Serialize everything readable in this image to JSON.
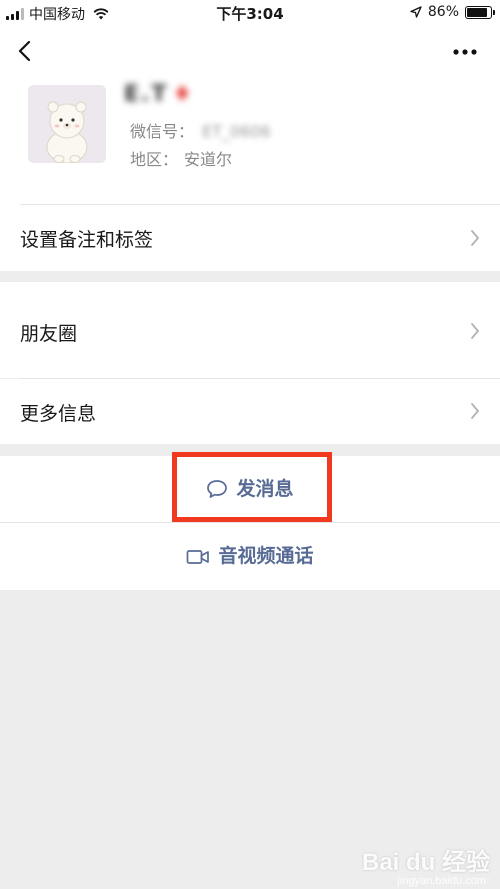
{
  "status_bar": {
    "carrier": "中国移动",
    "time": "下午3:04",
    "battery": "86%",
    "battery_level": 0.86,
    "icons": [
      "signal-icon",
      "wifi-icon",
      "location-arrow-icon",
      "battery-icon"
    ]
  },
  "nav": {
    "back_icon": "chevron-left-icon",
    "more_icon": "ellipsis-icon"
  },
  "profile": {
    "name": "E.T",
    "wechat_id_label": "微信号：",
    "wechat_id_value": "ET_0606",
    "region_label": "地区：",
    "region_value": "安道尔"
  },
  "rows": {
    "remark_tags": "设置备注和标签",
    "moments": "朋友圈",
    "more_info": "更多信息"
  },
  "actions": {
    "send_message": "发消息",
    "video_call": "音视频通话"
  },
  "colors": {
    "link": "#576b95",
    "highlight": "#f0391e",
    "background": "#ededed"
  },
  "watermark": {
    "text": "Bai du 经验",
    "sub": "jingyan.baidu.com"
  }
}
